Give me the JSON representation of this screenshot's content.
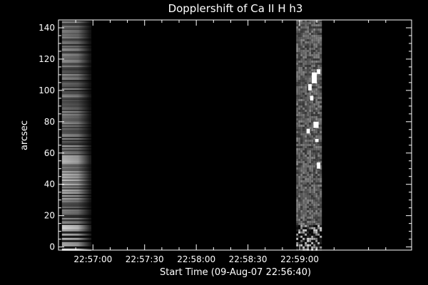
{
  "chart_data": {
    "type": "heatmap",
    "title": "Dopplershift of Ca II H h3",
    "xlabel": "Start Time (09-Aug-07 22:56:40)",
    "ylabel": "arcsec",
    "colormap": "grayscale",
    "background_color": "#000000",
    "x_unit": "seconds after 22:56:40",
    "xlim": [
      0,
      205
    ],
    "ylim": [
      -2,
      145
    ],
    "x_ticks": [
      {
        "value": 20,
        "label": "22:57:00"
      },
      {
        "value": 50,
        "label": "22:57:30"
      },
      {
        "value": 80,
        "label": "22:58:00"
      },
      {
        "value": 110,
        "label": "22:58:30"
      },
      {
        "value": 140,
        "label": "22:59:00"
      }
    ],
    "y_ticks": [
      {
        "value": 0,
        "label": "0"
      },
      {
        "value": 20,
        "label": "20"
      },
      {
        "value": 40,
        "label": "40"
      },
      {
        "value": 60,
        "label": "60"
      },
      {
        "value": 80,
        "label": "80"
      },
      {
        "value": 100,
        "label": "100"
      },
      {
        "value": 120,
        "label": "120"
      },
      {
        "value": 140,
        "label": "140"
      }
    ],
    "data_regions": [
      {
        "name": "left-block",
        "x_range": [
          2,
          19
        ],
        "y_range": [
          -2,
          145
        ],
        "pattern": "horizontal streaks, brighter near 40-60 arcsec, fading toward right"
      },
      {
        "name": "right-block",
        "x_range": [
          138,
          152
        ],
        "y_range": [
          -2,
          145
        ],
        "pattern": "mid-gray noise with white patches near 100-110 and 70-80 arcsec"
      }
    ]
  }
}
